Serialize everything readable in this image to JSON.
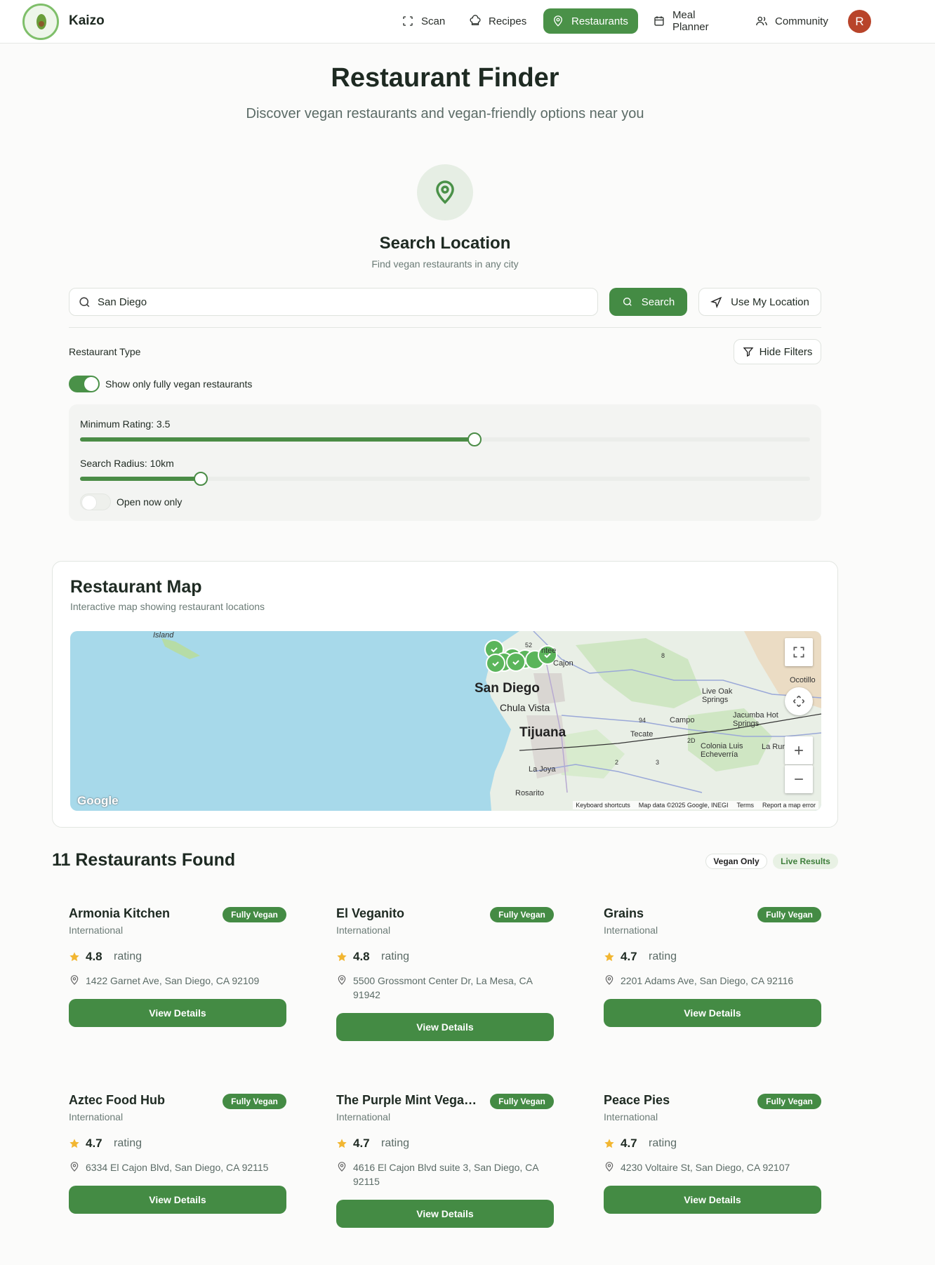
{
  "app": {
    "brand": "Kaizo",
    "avatar_initial": "R"
  },
  "nav": {
    "items": [
      {
        "label": "Scan",
        "icon": "scan-icon"
      },
      {
        "label": "Recipes",
        "icon": "chef-hat-icon"
      },
      {
        "label": "Restaurants",
        "icon": "map-pin-icon",
        "active": true
      },
      {
        "label": "Meal Planner",
        "icon": "calendar-icon"
      },
      {
        "label": "Community",
        "icon": "users-icon"
      }
    ]
  },
  "hero": {
    "title": "Restaurant Finder",
    "subtitle": "Discover vegan restaurants and vegan-friendly options near you"
  },
  "search": {
    "title": "Search Location",
    "subtitle": "Find vegan restaurants in any city",
    "value": "San Diego",
    "search_button": "Search",
    "location_button": "Use My Location"
  },
  "filters": {
    "section_label": "Restaurant Type",
    "toggle_filters_button": "Hide Filters",
    "vegan_only_label": "Show only fully vegan restaurants",
    "vegan_only": true,
    "min_rating_label": "Minimum Rating: 3.5",
    "min_rating": 3.5,
    "min_rating_fraction": 0.54,
    "radius_label": "Search Radius: 10km",
    "radius_km": 10,
    "radius_fraction": 0.165,
    "open_now_label": "Open now only",
    "open_now": false
  },
  "map": {
    "title": "Restaurant Map",
    "subtitle": "Interactive map showing restaurant locations",
    "labels": {
      "island": "Island",
      "san_diego": "San Diego",
      "chula_vista": "Chula Vista",
      "tijuana": "Tijuana",
      "la_joya": "La Joya",
      "rosarito": "Rosarito",
      "santee": "ntee",
      "el_cajon": "Cajon",
      "live_oak": "Live Oak Springs",
      "campo": "Campo",
      "tecate": "Tecate",
      "jacumba": "Jacumba Hot Springs",
      "ocotillo": "Ocotillo",
      "colonia": "Colonia Luis Echeverría",
      "la_rum": "La Rum",
      "route_52": "52",
      "route_8": "8",
      "route_94": "94",
      "route_2": "2",
      "route_3": "3",
      "route_2b": "2D"
    },
    "logo": "Google",
    "attribution": {
      "keyboard": "Keyboard shortcuts",
      "data": "Map data ©2025 Google, INEGI",
      "terms": "Terms",
      "report": "Report a map error"
    }
  },
  "results": {
    "title": "11 Restaurants Found",
    "badge_vegan": "Vegan Only",
    "badge_live": "Live Results",
    "rating_word": "rating",
    "view_label": "View Details",
    "vegan_badge": "Fully Vegan",
    "cards": [
      {
        "name": "Armonia Kitchen",
        "cuisine": "International",
        "rating": "4.8",
        "address": "1422 Garnet Ave, San Diego, CA 92109"
      },
      {
        "name": "El Veganito",
        "cuisine": "International",
        "rating": "4.8",
        "address": "5500 Grossmont Center Dr, La Mesa, CA 91942"
      },
      {
        "name": "Grains",
        "cuisine": "International",
        "rating": "4.7",
        "address": "2201 Adams Ave, San Diego, CA 92116"
      },
      {
        "name": "Aztec Food Hub",
        "cuisine": "International",
        "rating": "4.7",
        "address": "6334 El Cajon Blvd, San Diego, CA 92115"
      },
      {
        "name": "The Purple Mint Vegan ...",
        "cuisine": "International",
        "rating": "4.7",
        "address": "4616 El Cajon Blvd suite 3, San Diego, CA 92115"
      },
      {
        "name": "Peace Pies",
        "cuisine": "International",
        "rating": "4.7",
        "address": "4230 Voltaire St, San Diego, CA 92107"
      }
    ]
  },
  "colors": {
    "accent": "#448b44",
    "star": "#f2b631",
    "avatar": "#b8442a",
    "water": "#a7d9ea"
  }
}
